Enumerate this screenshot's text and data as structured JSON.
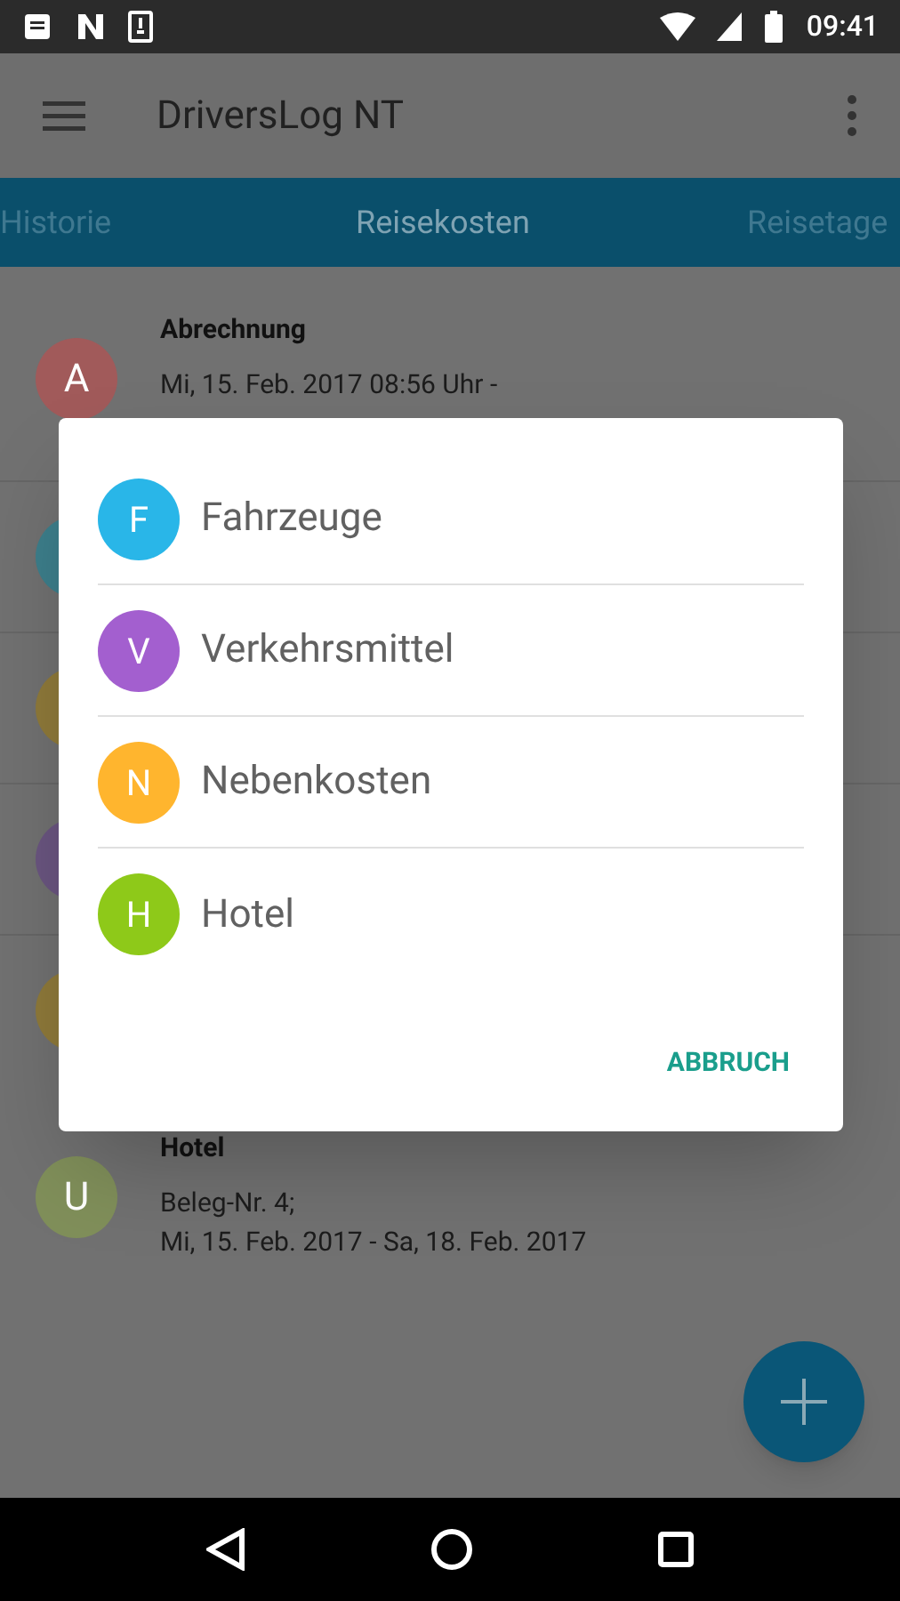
{
  "status_bar": {
    "time": "09:41"
  },
  "app_bar": {
    "title": "DriversLog NT"
  },
  "tabs": [
    {
      "label": "Historie",
      "selected": false
    },
    {
      "label": "Reisekosten",
      "selected": true
    },
    {
      "label": "Reisetage",
      "selected": false
    }
  ],
  "list_items": [
    {
      "kind": "entry",
      "avatar": "A",
      "color": "#a15a5a",
      "title": "Abrechnung",
      "lines": [
        "Mi, 15. Feb. 2017 08:56 Uhr -"
      ]
    },
    {
      "kind": "hidden",
      "color": "#3d7f8c"
    },
    {
      "kind": "hidden",
      "color": "#8f7a3a"
    },
    {
      "kind": "hidden",
      "color": "#6a5580"
    },
    {
      "kind": "hidden",
      "color": "#8f7a3a"
    },
    {
      "kind": "entry",
      "avatar": "U",
      "color": "#808f5a",
      "title": "Hotel",
      "lines": [
        "Beleg-Nr. 4;",
        "Mi, 15. Feb. 2017 - Sa, 18. Feb. 2017"
      ]
    }
  ],
  "dialog": {
    "options": [
      {
        "letter": "F",
        "color": "#29b6e8",
        "label": "Fahrzeuge"
      },
      {
        "letter": "V",
        "color": "#a35fcf",
        "label": "Verkehrsmittel"
      },
      {
        "letter": "N",
        "color": "#ffb52e",
        "label": "Nebenkosten"
      },
      {
        "letter": "H",
        "color": "#8ec919",
        "label": "Hotel"
      }
    ],
    "cancel": "ABBRUCH"
  }
}
